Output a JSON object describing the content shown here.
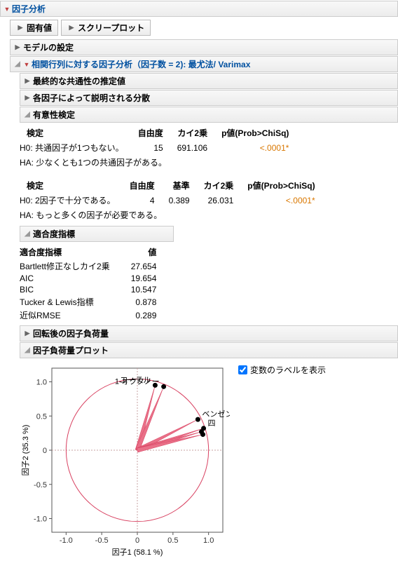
{
  "title": "因子分析",
  "buttons": {
    "eigen": "固有値",
    "scree": "スクリープロット"
  },
  "model_settings": "モデルの設定",
  "fa_header": "相関行列に対する因子分析（因子数 = 2): 最尤法/ Varimax",
  "final_comm": "最終的な共通性の推定値",
  "var_explained": "各因子によって説明される分散",
  "sig_test": "有意性検定",
  "test1": {
    "h_test": "検定",
    "h_df": "自由度",
    "h_chi": "カイ2乗",
    "h_p": "p値(Prob>ChiSq)",
    "h0": "H0: 共通因子が1つもない。",
    "df": "15",
    "chi": "691.106",
    "p": "<.0001*",
    "ha": "HA: 少なくとも1つの共通因子がある。"
  },
  "test2": {
    "h_test": "検定",
    "h_df": "自由度",
    "h_base": "基準",
    "h_chi": "カイ2乗",
    "h_p": "p値(Prob>ChiSq)",
    "h0": "H0: 2因子で十分である。",
    "df": "4",
    "base": "0.389",
    "chi": "26.031",
    "p": "<.0001*",
    "ha": "HA: もっと多くの因子が必要である。"
  },
  "fit_header": "適合度指標",
  "fit": {
    "h_name": "適合度指標",
    "h_val": "値",
    "rows": [
      {
        "name": "Bartlett修正なしカイ2乗",
        "val": "27.654"
      },
      {
        "name": "AIC",
        "val": "19.654"
      },
      {
        "name": "BIC",
        "val": "10.547"
      },
      {
        "name": "Tucker & Lewis指標",
        "val": "0.878"
      },
      {
        "name": "近似RMSE",
        "val": "0.289"
      }
    ]
  },
  "rotated_loadings": "回転後の因子負荷量",
  "loading_plot": "因子負荷量プロット",
  "show_labels": "変数のラベルを表示",
  "chart_data": {
    "type": "scatter",
    "xlabel": "因子1  (58.1 %)",
    "ylabel": "因子2  (35.3 %)",
    "xlim": [
      -1.2,
      1.2
    ],
    "ylim": [
      -1.2,
      1.2
    ],
    "ticks": [
      "-1.0",
      "-0.5",
      "0",
      "0.5",
      "1.0"
    ],
    "points": [
      {
        "label": "エーテル",
        "x": 0.25,
        "y": 0.95
      },
      {
        "label": "1-オクタノー",
        "x": 0.37,
        "y": 0.93
      },
      {
        "label": "ベンゼン",
        "x": 0.85,
        "y": 0.45
      },
      {
        "label": "四",
        "x": 0.93,
        "y": 0.32
      },
      {
        "label": "",
        "x": 0.9,
        "y": 0.27
      },
      {
        "label": "",
        "x": 0.92,
        "y": 0.23
      }
    ]
  }
}
